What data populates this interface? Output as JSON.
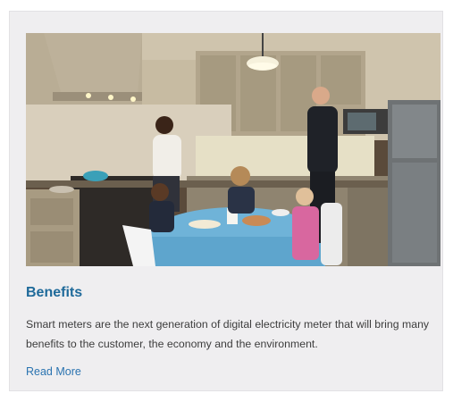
{
  "card": {
    "title": "Benefits",
    "description": "Smart meters are the next generation of digital electricity meter that will bring many benefits to the customer, the economy and the environment.",
    "link_label": "Read More"
  },
  "colors": {
    "card_background": "#efeef0",
    "title": "#1f6a9a",
    "link": "#2a73b0",
    "body_text": "#3d3d3d"
  }
}
